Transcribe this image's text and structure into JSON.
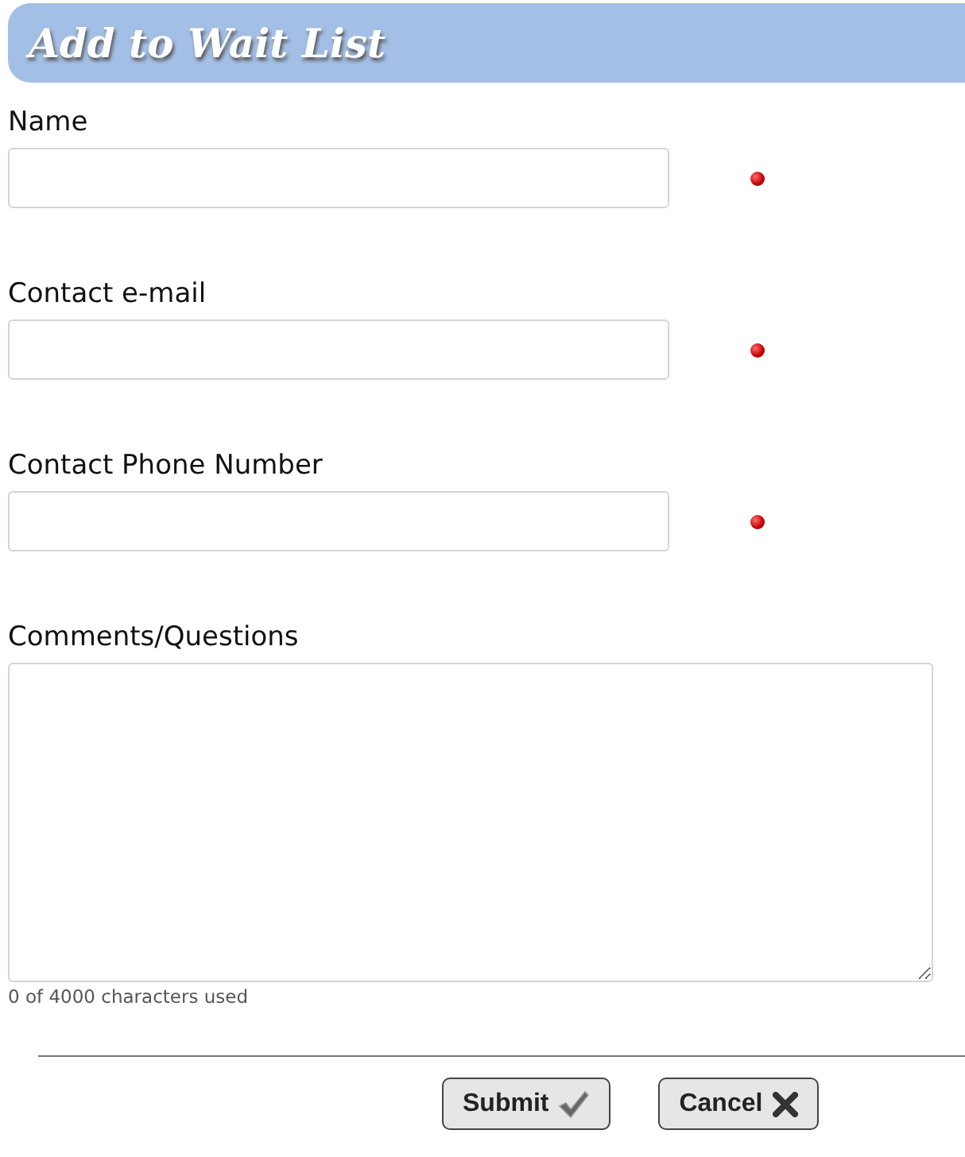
{
  "header": {
    "title": "Add to Wait List"
  },
  "fields": [
    {
      "kind": "text",
      "label": "Name",
      "required": true
    },
    {
      "kind": "text",
      "label": "Contact e-mail",
      "required": true
    },
    {
      "kind": "text",
      "label": "Contact Phone Number",
      "required": true
    },
    {
      "kind": "textarea",
      "label": "Comments/Questions",
      "counter": "0 of 4000 characters used"
    }
  ],
  "buttons": [
    {
      "kind": "submit",
      "label": "Submit"
    },
    {
      "kind": "cancel",
      "label": "Cancel"
    }
  ]
}
